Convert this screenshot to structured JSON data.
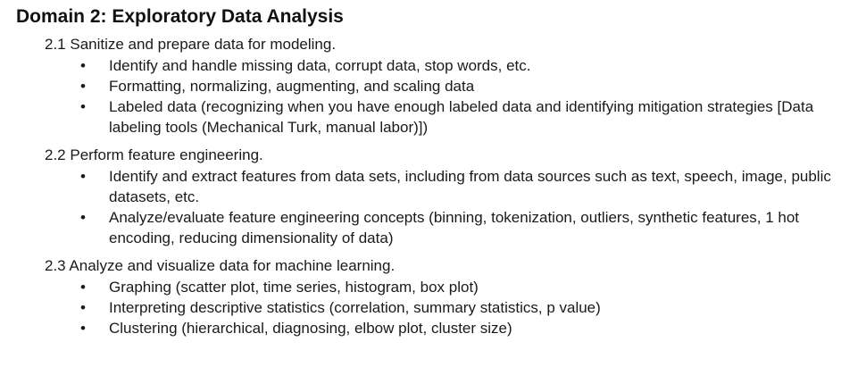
{
  "domain": {
    "title": "Domain 2: Exploratory Data Analysis"
  },
  "sections": [
    {
      "heading": "2.1 Sanitize and prepare data for modeling.",
      "bullets": [
        "Identify and handle missing data, corrupt data, stop words, etc.",
        "Formatting, normalizing, augmenting, and scaling data",
        "Labeled data (recognizing when you have enough labeled data and identifying mitigation strategies [Data labeling tools (Mechanical Turk, manual labor)])"
      ]
    },
    {
      "heading": "2.2 Perform feature engineering.",
      "bullets": [
        "Identify and extract features from data sets, including from data sources such as text, speech, image, public datasets, etc.",
        "Analyze/evaluate feature engineering concepts (binning, tokenization, outliers, synthetic features, 1 hot encoding, reducing dimensionality of data)"
      ]
    },
    {
      "heading": "2.3 Analyze and visualize data for machine learning.",
      "bullets": [
        "Graphing (scatter plot, time series, histogram, box plot)",
        "Interpreting descriptive statistics (correlation, summary statistics, p value)",
        "Clustering (hierarchical, diagnosing, elbow plot, cluster size)"
      ]
    }
  ],
  "bullet_glyph": "•"
}
